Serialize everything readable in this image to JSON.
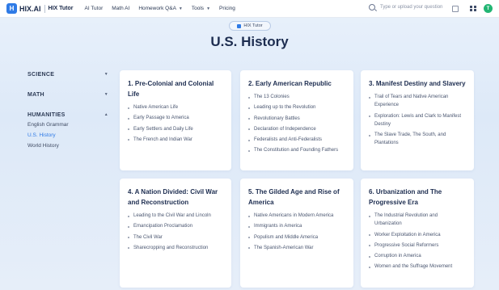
{
  "topbar": {
    "logo_text": "HIX.AI",
    "logo_sub": "HIX Tutor",
    "nav": [
      {
        "label": "AI Tutor"
      },
      {
        "label": "Math AI"
      },
      {
        "label": "Homework Q&A"
      },
      {
        "label": "Tools"
      },
      {
        "label": "Pricing"
      }
    ],
    "search_placeholder": "Type or upload your question",
    "avatar_letter": "T"
  },
  "header": {
    "badge": "HIX Tutor",
    "title": "U.S. History"
  },
  "sidebar": {
    "categories": [
      {
        "label": "SCIENCE"
      },
      {
        "label": "MATH"
      },
      {
        "label": "HUMANITIES"
      }
    ],
    "humanities_items": [
      {
        "label": "English Grammar"
      },
      {
        "label": "U.S. History"
      },
      {
        "label": "World History"
      }
    ]
  },
  "cards": [
    {
      "title": "1. Pre-Colonial and Colonial Life",
      "items": [
        "Native American Life",
        "Early Passage to America",
        "Early Settlers and Daily Life",
        "The French and Indian War"
      ]
    },
    {
      "title": "2. Early American Republic",
      "items": [
        "The 13 Colonies",
        "Leading up to the Revolution",
        "Revolutionary Battles",
        "Declaration of Independence",
        "Federalists and Anti-Federalists",
        "The Constitution and Founding Fathers"
      ]
    },
    {
      "title": "3. Manifest Destiny and Slavery",
      "items": [
        "Trail of Tears and Native American Experience",
        "Exploration: Lewis and Clark to Manifest Destiny",
        "The Slave Trade, The South, and Plantations"
      ]
    },
    {
      "title": "4. A Nation Divided: Civil War and Reconstruction",
      "items": [
        "Leading to the Civil War and Lincoln",
        "Emancipation Proclamation",
        "The Civil War",
        "Sharecropping and Reconstruction"
      ]
    },
    {
      "title": "5. The Gilded Age and Rise of America",
      "items": [
        "Native Americans in Modern America",
        "Immigrants in America",
        "Populism and Middle America",
        "The Spanish-American War"
      ]
    },
    {
      "title": "6. Urbanization and The Progressive Era",
      "items": [
        "The Industrial Revolution and Urbanization",
        "Worker Exploitation in America",
        "Progressive Social Reformers",
        "Corruption in America",
        "Women and the Suffrage Movement"
      ]
    }
  ]
}
